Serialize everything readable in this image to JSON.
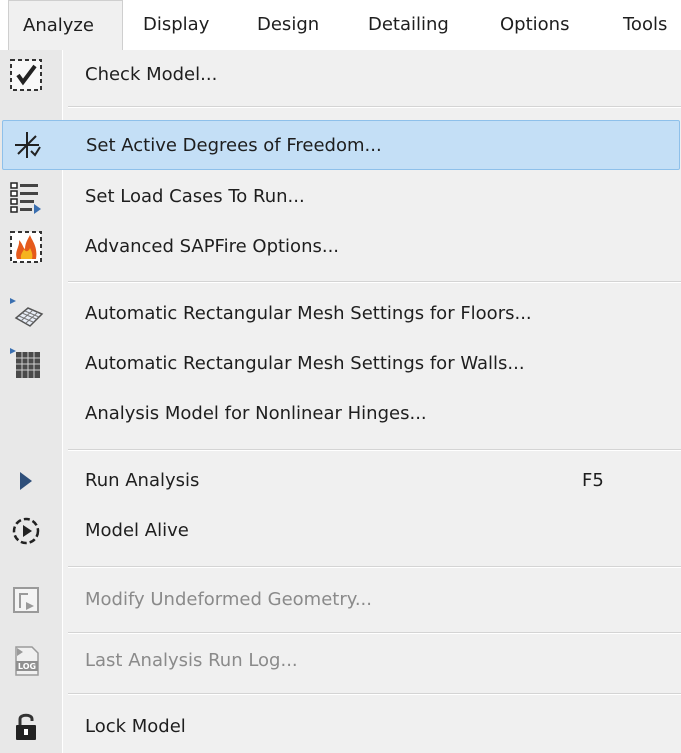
{
  "menubar": {
    "items": [
      {
        "label": "Analyze"
      },
      {
        "label": "Display"
      },
      {
        "label": "Design"
      },
      {
        "label": "Detailing"
      },
      {
        "label": "Options"
      },
      {
        "label": "Tools"
      }
    ]
  },
  "menu": {
    "items": [
      {
        "label": "Check Model...",
        "icon": "check-model-icon"
      },
      {
        "label": "Set Active Degrees of Freedom...",
        "icon": "degrees-of-freedom-icon",
        "state": "highlighted"
      },
      {
        "label": "Set Load Cases To Run...",
        "icon": "load-cases-list-icon"
      },
      {
        "label": "Advanced SAPFire Options...",
        "icon": "sapfire-flame-icon"
      },
      {
        "label": "Automatic Rectangular Mesh Settings for Floors...",
        "icon": "floor-mesh-icon"
      },
      {
        "label": "Automatic Rectangular Mesh Settings for Walls...",
        "icon": "wall-mesh-icon"
      },
      {
        "label": "Analysis Model for Nonlinear Hinges...",
        "icon": ""
      },
      {
        "label": "Run Analysis",
        "icon": "run-play-icon",
        "shortcut": "F5"
      },
      {
        "label": "Model Alive",
        "icon": "model-alive-icon"
      },
      {
        "label": "Modify Undeformed Geometry...",
        "icon": "modify-geometry-icon",
        "state": "disabled"
      },
      {
        "label": "Last Analysis Run Log...",
        "icon": "log-file-icon",
        "state": "disabled"
      },
      {
        "label": "Lock Model",
        "icon": "lock-icon"
      }
    ]
  },
  "colors": {
    "highlight": "#c4dff6",
    "highlight_border": "#8ec0ea",
    "disabled_text": "#8a8a8a"
  }
}
